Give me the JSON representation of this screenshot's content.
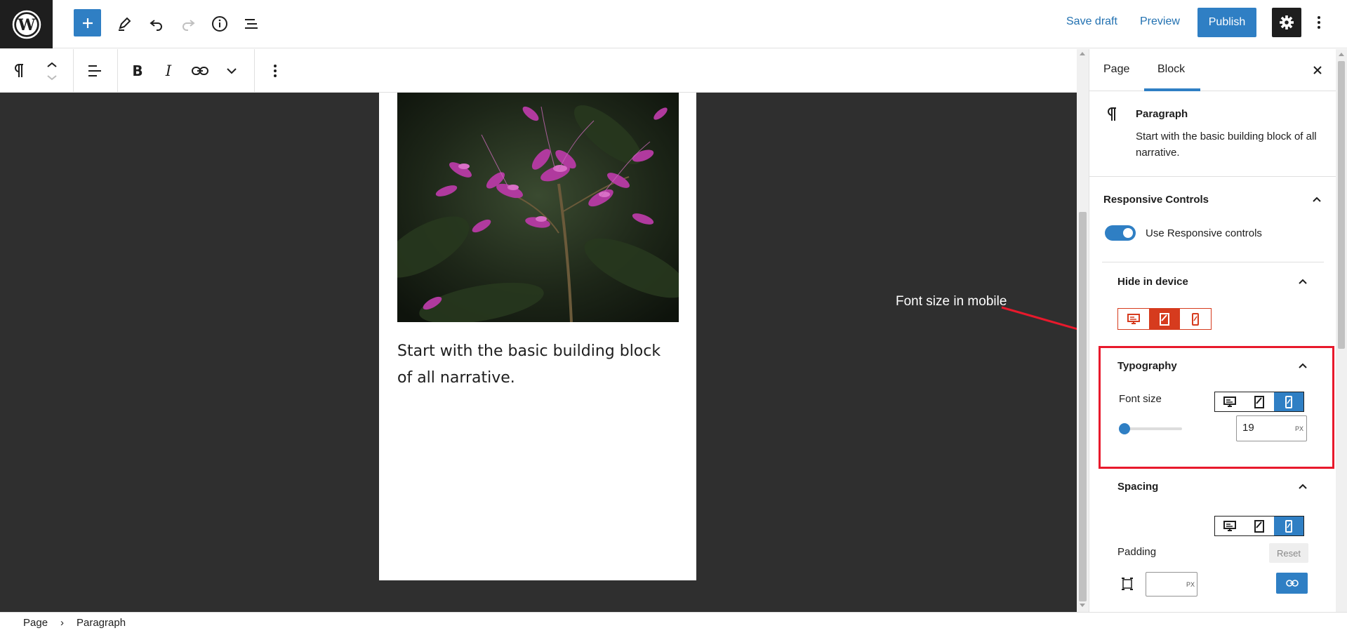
{
  "topbar": {
    "save_draft": "Save draft",
    "preview": "Preview",
    "publish": "Publish",
    "icons": [
      "wordpress-logo",
      "plus-icon",
      "pencil-icon",
      "undo-icon",
      "redo-icon",
      "info-icon",
      "list-view-icon",
      "gear-icon",
      "more-vertical-icon"
    ]
  },
  "block_toolbar": {
    "icons": [
      "paragraph-icon",
      "move-up-down-icon",
      "align-icon",
      "bold-icon",
      "italic-icon",
      "link-icon",
      "chevron-down-icon",
      "more-vertical-icon"
    ],
    "bold": "B",
    "italic": "I"
  },
  "canvas": {
    "paragraph_text": "Start with the basic building block of all narrative.",
    "annotation": "Font size in mobile"
  },
  "sidebar": {
    "tabs": [
      {
        "label": "Page",
        "active": false
      },
      {
        "label": "Block",
        "active": true
      }
    ],
    "block_card": {
      "title": "Paragraph",
      "description": "Start with the basic building block of all narrative."
    },
    "responsive_controls": {
      "title": "Responsive Controls",
      "toggle_label": "Use Responsive controls",
      "toggle_on": true
    },
    "hide_in_device": {
      "title": "Hide in device",
      "devices": [
        "desktop",
        "tablet",
        "mobile"
      ],
      "active": [
        "tablet"
      ]
    },
    "typography": {
      "title": "Typography",
      "font_size_label": "Font size",
      "devices": [
        "desktop",
        "tablet",
        "mobile"
      ],
      "active_device": "mobile",
      "font_size_value": "19",
      "unit": "PX"
    },
    "spacing": {
      "title": "Spacing",
      "devices": [
        "desktop",
        "tablet",
        "mobile"
      ],
      "active_device": "mobile",
      "padding_label": "Padding",
      "reset_label": "Reset",
      "padding_value": "",
      "unit": "PX"
    }
  },
  "breadcrumb": {
    "items": [
      "Page",
      "Paragraph"
    ],
    "separator": "›"
  },
  "colors": {
    "accent": "#2f7fc4",
    "dark": "#1e1e1e",
    "canvas_bg": "#2f2f2f",
    "hide_device_red": "#d63b1e",
    "annotation_red": "#e8192c"
  }
}
